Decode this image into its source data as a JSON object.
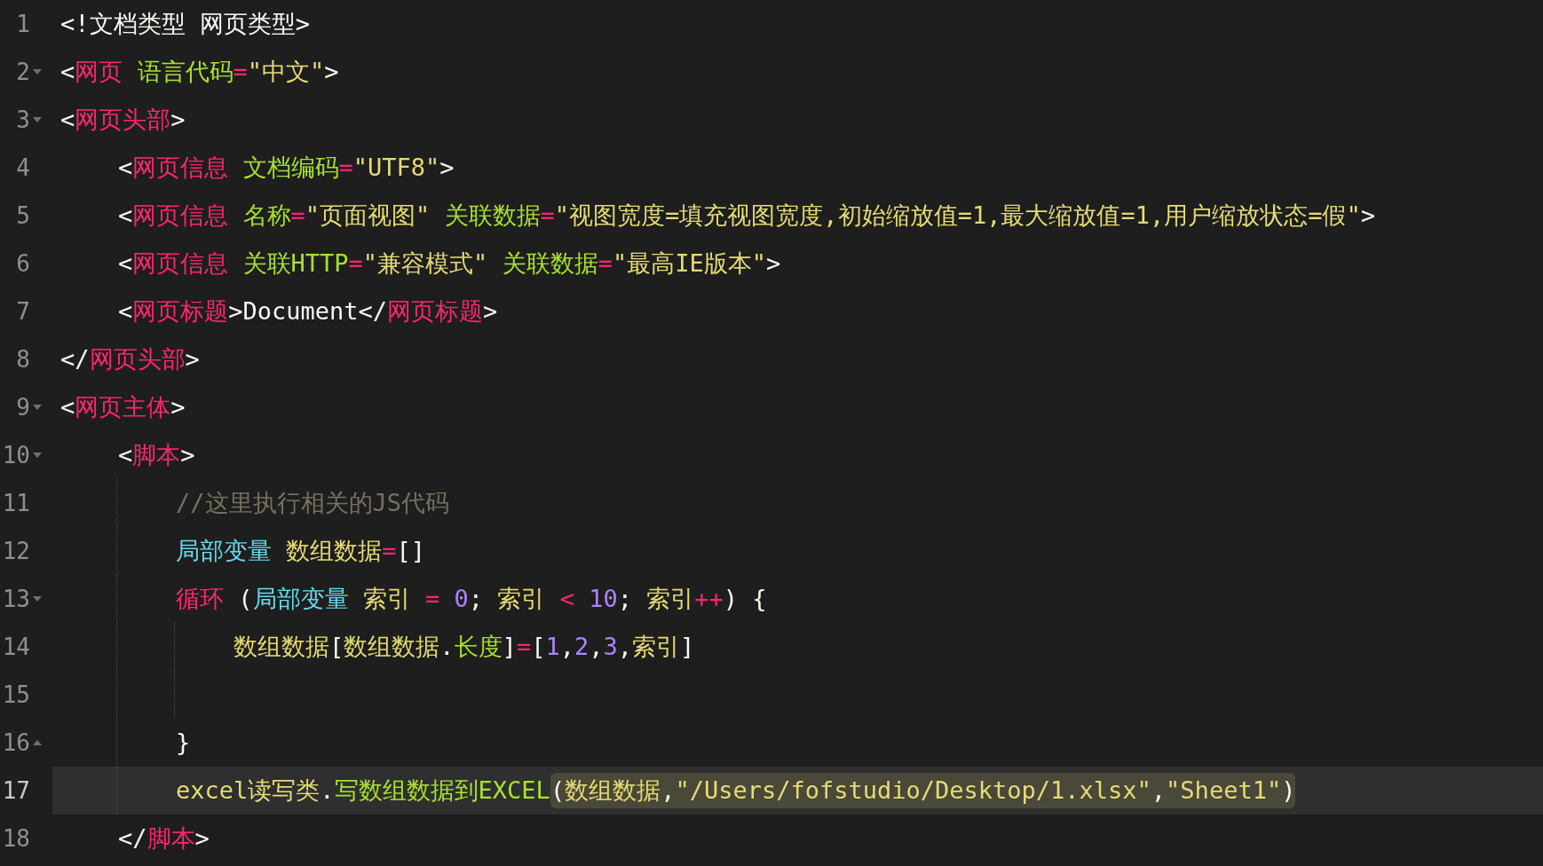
{
  "editor": {
    "lines": [
      {
        "number": "1",
        "active": false,
        "tokens": [
          {
            "kind": "punct",
            "text": "<!文档类型 网页类型>"
          }
        ]
      },
      {
        "number": "2",
        "expanded": true,
        "active": false,
        "tokens": [
          {
            "kind": "punct",
            "text": "<"
          },
          {
            "kind": "tag",
            "text": "网页"
          },
          {
            "kind": "attr",
            "text": " 语言代码"
          },
          {
            "kind": "operator",
            "text": "="
          },
          {
            "kind": "string",
            "text": "\"中文\""
          },
          {
            "kind": "punct",
            "text": ">"
          }
        ]
      },
      {
        "number": "3",
        "expanded": true,
        "active": false,
        "tokens": [
          {
            "kind": "punct",
            "text": "<"
          },
          {
            "kind": "tag",
            "text": "网页头部"
          },
          {
            "kind": "punct",
            "text": ">"
          }
        ]
      },
      {
        "number": "4",
        "active": false,
        "tokens": [
          {
            "kind": "punct",
            "text": "    <"
          },
          {
            "kind": "tag",
            "text": "网页信息"
          },
          {
            "kind": "attr",
            "text": " 文档编码"
          },
          {
            "kind": "operator",
            "text": "="
          },
          {
            "kind": "string",
            "text": "\"UTF8\""
          },
          {
            "kind": "punct",
            "text": ">"
          }
        ]
      },
      {
        "number": "5",
        "active": false,
        "tokens": [
          {
            "kind": "punct",
            "text": "    <"
          },
          {
            "kind": "tag",
            "text": "网页信息"
          },
          {
            "kind": "attr",
            "text": " 名称"
          },
          {
            "kind": "operator",
            "text": "="
          },
          {
            "kind": "string",
            "text": "\"页面视图\""
          },
          {
            "kind": "attr",
            "text": " 关联数据"
          },
          {
            "kind": "operator",
            "text": "="
          },
          {
            "kind": "string",
            "text": "\"视图宽度=填充视图宽度,初始缩放值=1,最大缩放值=1,用户缩放状态=假\""
          },
          {
            "kind": "punct",
            "text": ">"
          }
        ]
      },
      {
        "number": "6",
        "active": false,
        "tokens": [
          {
            "kind": "punct",
            "text": "    <"
          },
          {
            "kind": "tag",
            "text": "网页信息"
          },
          {
            "kind": "attr",
            "text": " 关联HTTP"
          },
          {
            "kind": "operator",
            "text": "="
          },
          {
            "kind": "string",
            "text": "\"兼容模式\""
          },
          {
            "kind": "attr",
            "text": " 关联数据"
          },
          {
            "kind": "operator",
            "text": "="
          },
          {
            "kind": "string",
            "text": "\"最高IE版本\""
          },
          {
            "kind": "punct",
            "text": ">"
          }
        ]
      },
      {
        "number": "7",
        "active": false,
        "tokens": [
          {
            "kind": "punct",
            "text": "    <"
          },
          {
            "kind": "tag",
            "text": "网页标题"
          },
          {
            "kind": "punct",
            "text": ">Document</"
          },
          {
            "kind": "tag",
            "text": "网页标题"
          },
          {
            "kind": "punct",
            "text": ">"
          }
        ]
      },
      {
        "number": "8",
        "active": false,
        "tokens": [
          {
            "kind": "punct",
            "text": "</"
          },
          {
            "kind": "tag",
            "text": "网页头部"
          },
          {
            "kind": "punct",
            "text": ">"
          }
        ]
      },
      {
        "number": "9",
        "expanded": true,
        "active": false,
        "tokens": [
          {
            "kind": "punct",
            "text": "<"
          },
          {
            "kind": "tag",
            "text": "网页主体"
          },
          {
            "kind": "punct",
            "text": ">"
          }
        ]
      },
      {
        "number": "10",
        "expanded": true,
        "active": false,
        "tokens": [
          {
            "kind": "punct",
            "text": "    <"
          },
          {
            "kind": "tag",
            "text": "脚本"
          },
          {
            "kind": "punct",
            "text": ">"
          }
        ]
      },
      {
        "number": "11",
        "active": false,
        "tokens": [
          {
            "kind": "comment",
            "text": "        //这里执行相关的JS代码"
          }
        ]
      },
      {
        "number": "12",
        "active": false,
        "tokens": [
          {
            "kind": "storage",
            "text": "        局部变量"
          },
          {
            "kind": "variable",
            "text": " 数组数据"
          },
          {
            "kind": "operator",
            "text": "="
          },
          {
            "kind": "punct",
            "text": "[]"
          }
        ]
      },
      {
        "number": "13",
        "expanded": true,
        "active": false,
        "tokens": [
          {
            "kind": "keyword",
            "text": "        循环"
          },
          {
            "kind": "punct",
            "text": " ("
          },
          {
            "kind": "storage",
            "text": "局部变量"
          },
          {
            "kind": "variable",
            "text": " 索引 "
          },
          {
            "kind": "operator",
            "text": "="
          },
          {
            "kind": "number",
            "text": " 0"
          },
          {
            "kind": "punct",
            "text": "; "
          },
          {
            "kind": "variable",
            "text": "索引 "
          },
          {
            "kind": "operator",
            "text": "<"
          },
          {
            "kind": "number",
            "text": " 10"
          },
          {
            "kind": "punct",
            "text": "; "
          },
          {
            "kind": "variable",
            "text": "索引"
          },
          {
            "kind": "operator",
            "text": "++"
          },
          {
            "kind": "punct",
            "text": ") {"
          }
        ]
      },
      {
        "number": "14",
        "active": false,
        "tokens": [
          {
            "kind": "variable",
            "text": "            数组数据"
          },
          {
            "kind": "punct",
            "text": "["
          },
          {
            "kind": "variable",
            "text": "数组数据"
          },
          {
            "kind": "punct",
            "text": "."
          },
          {
            "kind": "function",
            "text": "长度"
          },
          {
            "kind": "punct",
            "text": "]"
          },
          {
            "kind": "operator",
            "text": "="
          },
          {
            "kind": "punct",
            "text": "["
          },
          {
            "kind": "number",
            "text": "1"
          },
          {
            "kind": "punct",
            "text": ","
          },
          {
            "kind": "number",
            "text": "2"
          },
          {
            "kind": "punct",
            "text": ","
          },
          {
            "kind": "number",
            "text": "3"
          },
          {
            "kind": "punct",
            "text": ","
          },
          {
            "kind": "variable",
            "text": "索引"
          },
          {
            "kind": "punct",
            "text": "]"
          }
        ]
      },
      {
        "number": "15",
        "active": false
      },
      {
        "number": "16",
        "expanded": false,
        "active": false,
        "tokens": [
          {
            "kind": "punct",
            "text": "        }"
          }
        ]
      },
      {
        "number": "17",
        "active": true,
        "tokens": [
          {
            "kind": "variable",
            "text": "        excel读写类"
          },
          {
            "kind": "punct",
            "text": "."
          },
          {
            "kind": "function",
            "text": "写数组数据到EXCEL"
          }
        ],
        "bracket_match_tokens": [
          {
            "kind": "punct",
            "text": "("
          },
          {
            "kind": "variable",
            "text": "数组数据"
          },
          {
            "kind": "punct",
            "text": ","
          },
          {
            "kind": "string",
            "text": "\"/Users/fofstudio/Desktop/1.xlsx\""
          },
          {
            "kind": "punct",
            "text": ","
          },
          {
            "kind": "string",
            "text": "\"Sheet1\""
          },
          {
            "kind": "punct",
            "text": ")"
          }
        ]
      },
      {
        "number": "18",
        "active": false,
        "tokens": [
          {
            "kind": "punct",
            "text": "    </"
          },
          {
            "kind": "tag",
            "text": "脚本"
          },
          {
            "kind": "punct",
            "text": ">"
          }
        ]
      }
    ]
  }
}
